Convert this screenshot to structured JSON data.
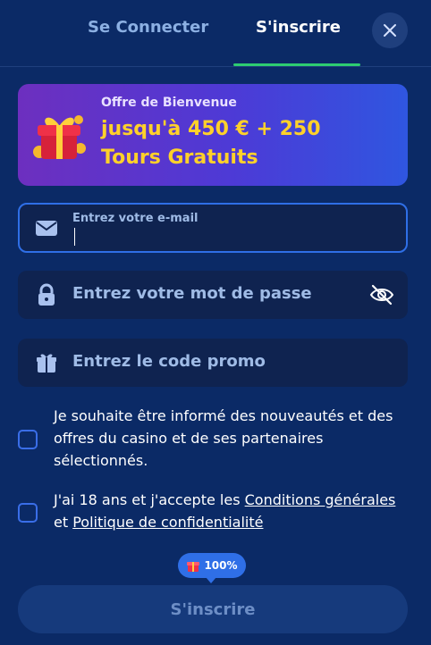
{
  "tabs": {
    "login_label": "Se Connecter",
    "signup_label": "S'inscrire"
  },
  "banner": {
    "subtitle": "Offre de Bienvenue",
    "title_line1": "jusqu'à 450 € + 250",
    "title_line2": "Tours Gratuits",
    "icon": "gift-icon"
  },
  "form": {
    "email": {
      "label": "Entrez votre e-mail",
      "value": "",
      "icon": "envelope-icon"
    },
    "password": {
      "placeholder": "Entrez votre mot de passe",
      "icon": "lock-icon",
      "toggle_icon": "eye-off-icon"
    },
    "promo": {
      "placeholder": "Entrez le code promo",
      "icon": "gift-icon"
    },
    "newsletter": {
      "text": "Je souhaite être informé des nouveautés et des offres du casino et de ses partenaires sélectionnés.",
      "checked": false
    },
    "terms": {
      "text_start": "J'ai 18 ans et j'accepte les ",
      "link_terms": "Conditions générales",
      "text_mid": " et ",
      "link_privacy": "Politique de confidentialité",
      "checked": false
    },
    "progress_badge": "100%",
    "submit_label": "S'inscrire"
  },
  "colors": {
    "background": "#0b2a66",
    "accent_green": "#2ecc71",
    "accent_blue": "#2f6fe7",
    "bonus_yellow": "#ffd12a"
  }
}
